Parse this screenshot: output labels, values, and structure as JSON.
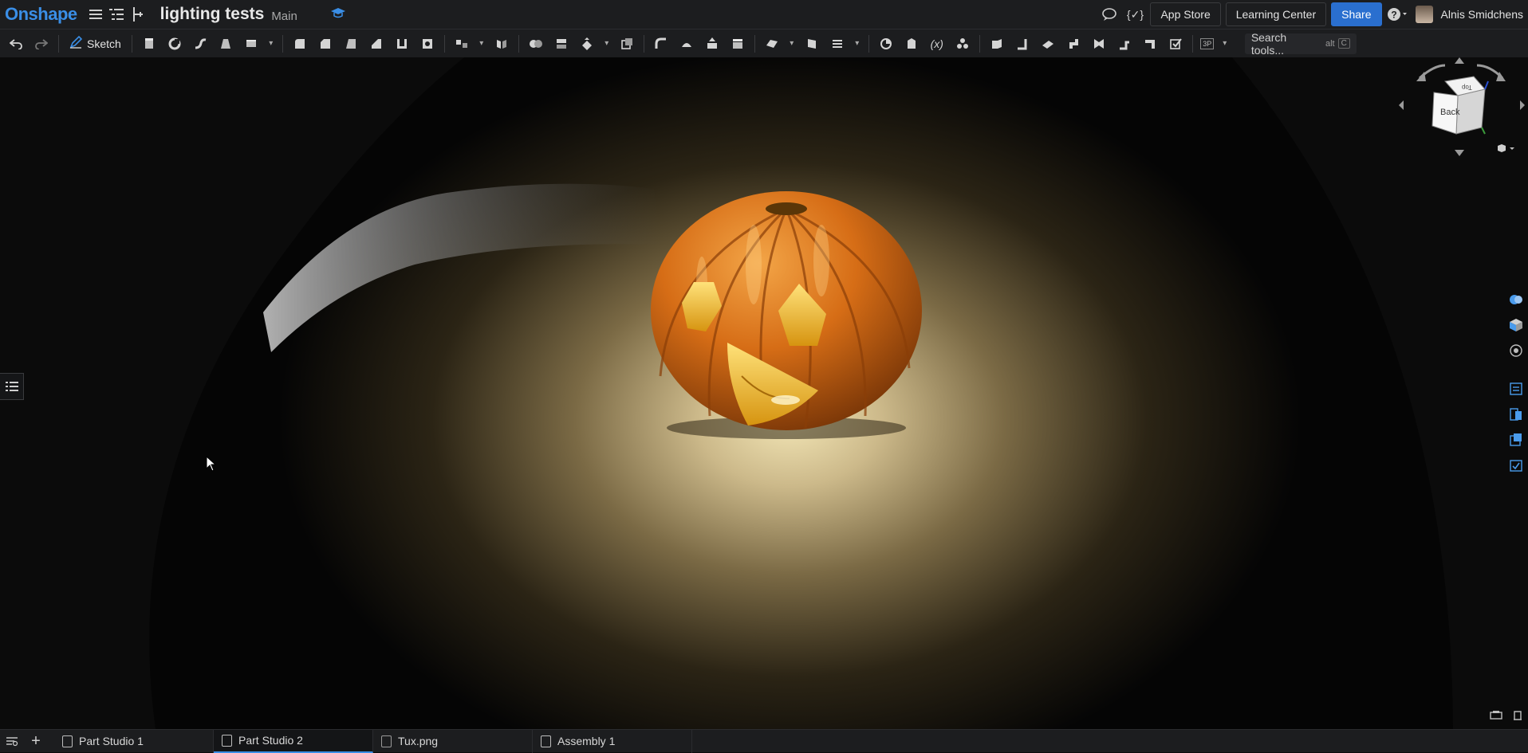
{
  "app": {
    "logo": "Onshape"
  },
  "document": {
    "title": "lighting tests",
    "branch": "Main"
  },
  "header": {
    "app_store": "App Store",
    "learning_center": "Learning Center",
    "share": "Share",
    "help": "?",
    "user_name": "Alnis Smidchens"
  },
  "toolbar": {
    "sketch_label": "Sketch",
    "view_mode": "3P",
    "search_placeholder": "Search tools...",
    "search_shortcut_mod": "alt",
    "search_shortcut_key": "C",
    "variable_label": "(x)"
  },
  "view_cube": {
    "face_label": "Back",
    "top_face": "Top"
  },
  "tabs": [
    {
      "label": "Part Studio 1",
      "active": false
    },
    {
      "label": "Part Studio 2",
      "active": true
    },
    {
      "label": "Tux.png",
      "active": false
    },
    {
      "label": "Assembly 1",
      "active": false
    }
  ],
  "colors": {
    "accent": "#3a8ee6",
    "share": "#2a6fcf",
    "pumpkin": "#d9741c"
  }
}
